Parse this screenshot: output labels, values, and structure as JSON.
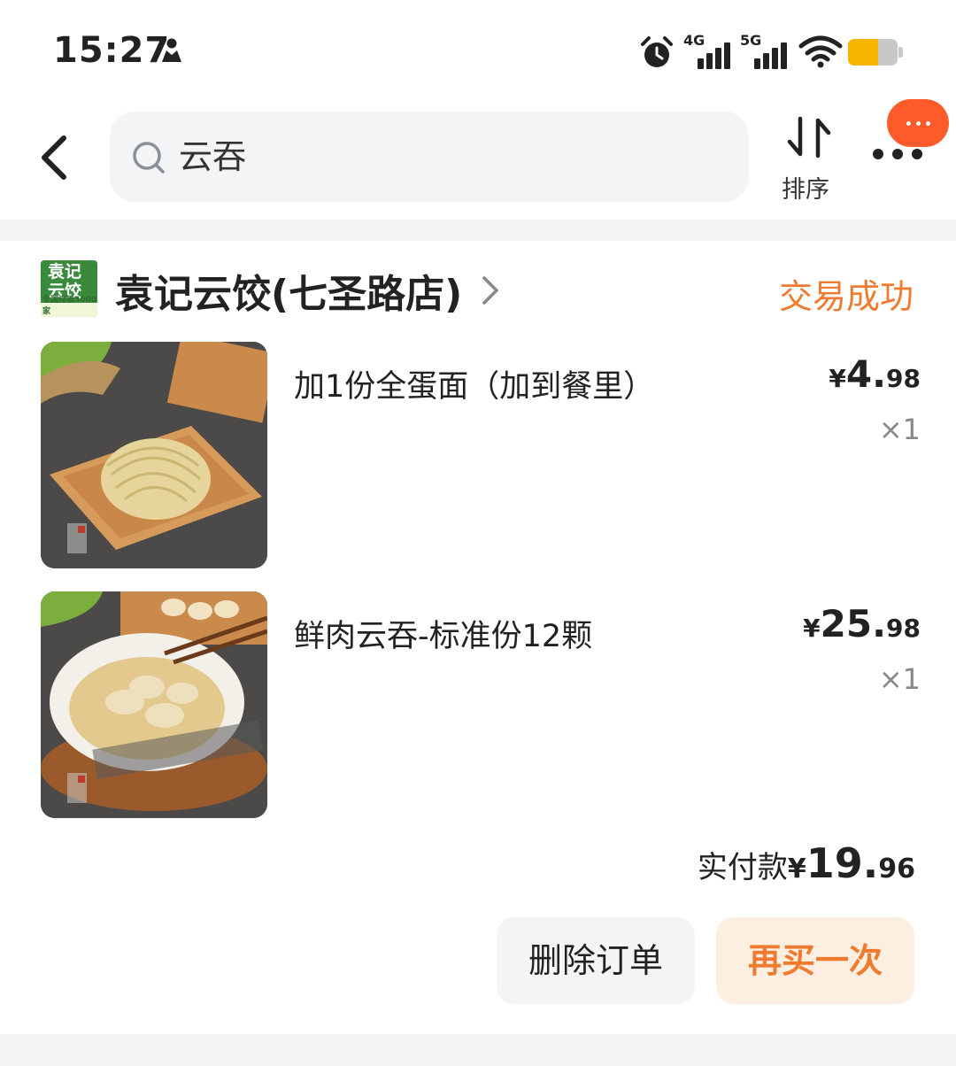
{
  "status_bar": {
    "time": "15:27",
    "signal_1_label": "4G",
    "signal_2_label": "5G",
    "battery_level": 0.6,
    "icons": [
      "person-icon",
      "alarm-icon",
      "signal-icon",
      "wifi-icon",
      "battery-icon"
    ]
  },
  "top_bar": {
    "search_query": "云吞",
    "sort_label": "排序",
    "icons": [
      "back-icon",
      "search-icon",
      "sort-icon",
      "more-icon"
    ]
  },
  "order": {
    "store_name": "袁记云饺(七圣路店)",
    "store_logo_text": "袁记云饺",
    "store_logo_band": "全国连锁3000家",
    "status": "交易成功",
    "items": [
      {
        "name": "加1份全蛋面（加到餐里）",
        "currency": "¥",
        "price_int": "4.",
        "price_dec": "98",
        "qty": "×1"
      },
      {
        "name": "鲜肉云吞-标准份12颗",
        "currency": "¥",
        "price_int": "25.",
        "price_dec": "98",
        "qty": "×1"
      }
    ],
    "total_label": "实付款",
    "total_currency": "¥",
    "total_int": "19.",
    "total_dec": "96",
    "delete_button": "删除订单",
    "rebuy_button": "再买一次"
  },
  "colors": {
    "accent": "#f07a2d",
    "float_badge": "#ff5a2a",
    "battery": "#f7b500",
    "logo_green": "#3a8a3c"
  }
}
